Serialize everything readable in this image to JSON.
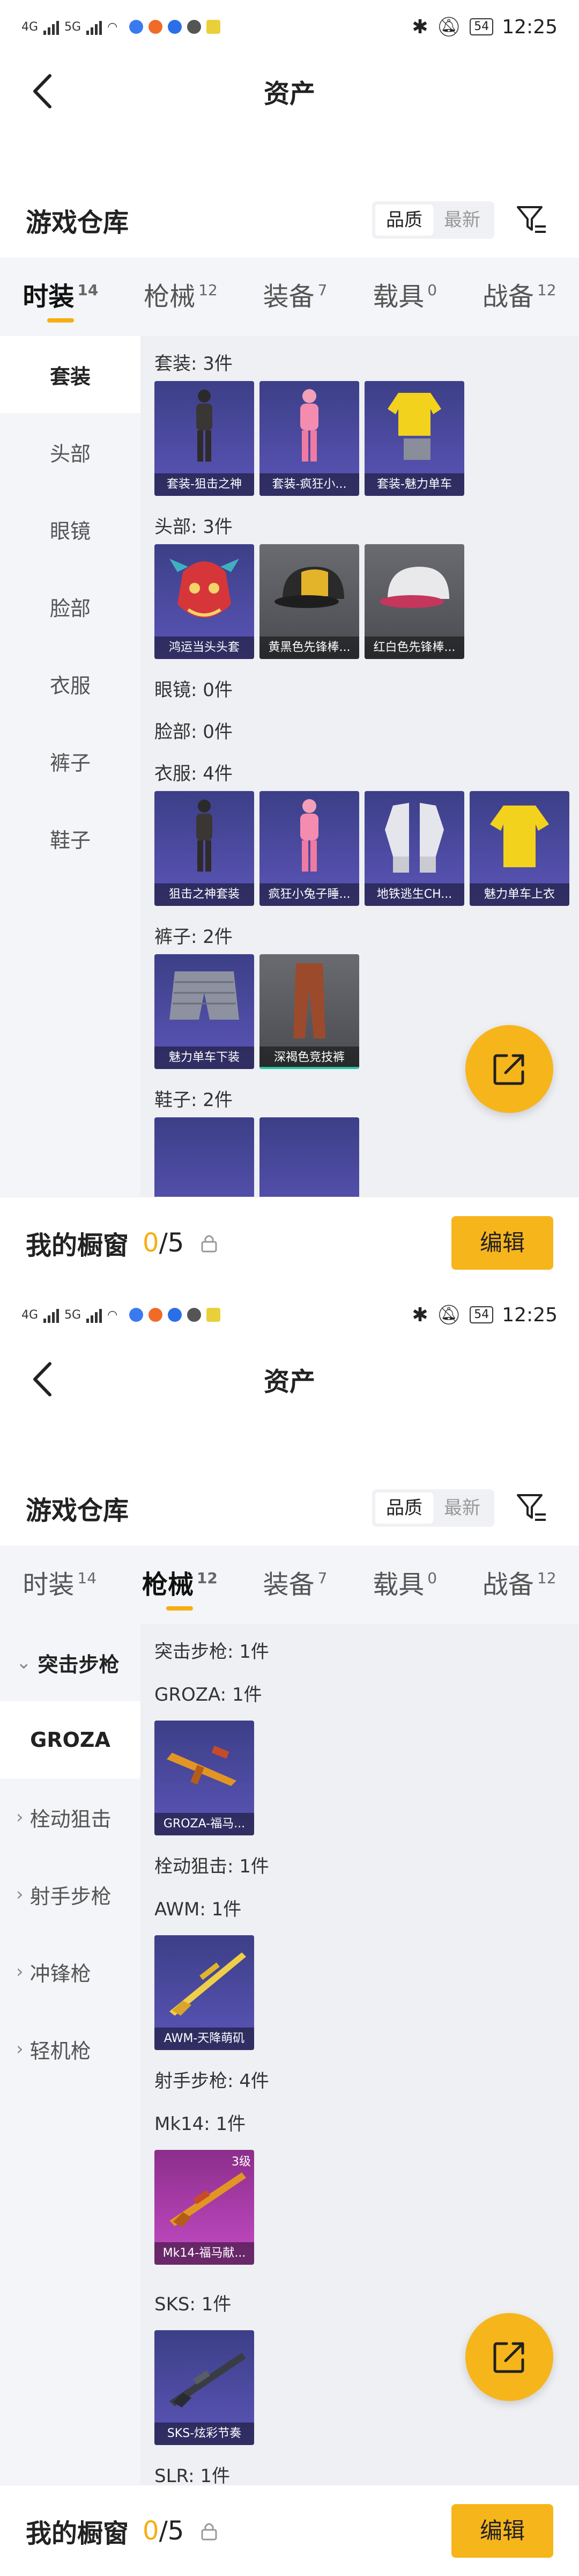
{
  "screens": [
    {
      "status": {
        "net": "4G",
        "net2": "5G",
        "time": "12:25",
        "battery": "54"
      },
      "nav": {
        "title": "资产"
      },
      "warehouse": {
        "title": "游戏仓库",
        "sort_quality": "品质",
        "sort_latest": "最新"
      },
      "tabs": [
        {
          "label": "时装",
          "count": "14"
        },
        {
          "label": "枪械",
          "count": "12"
        },
        {
          "label": "装备",
          "count": "7"
        },
        {
          "label": "载具",
          "count": "0"
        },
        {
          "label": "战备",
          "count": "12"
        }
      ],
      "sidebar": [
        "套装",
        "头部",
        "眼镜",
        "脸部",
        "衣服",
        "裤子",
        "鞋子"
      ],
      "sections": {
        "s1": "套装: 3件",
        "s1_items": [
          "套装-狙击之神",
          "套装-疯狂小...",
          "套装-魅力单车"
        ],
        "s2": "头部: 3件",
        "s2_items": [
          "鸿运当头头套",
          "黄黑色先锋棒...",
          "红白色先锋棒..."
        ],
        "s3": "眼镜: 0件",
        "s4": "脸部: 0件",
        "s5": "衣服: 4件",
        "s5_items": [
          "狙击之神套装",
          "疯狂小兔子睡...",
          "地铁逃生CH...",
          "魅力单车上衣"
        ],
        "s6": "裤子: 2件",
        "s6_items": [
          "魅力单车下装",
          "深褐色竞技裤"
        ],
        "s7": "鞋子: 2件"
      },
      "bottom": {
        "label": "我的橱窗",
        "count_current": "0",
        "count_total": "/5",
        "edit": "编辑"
      }
    },
    {
      "status": {
        "net": "4G",
        "net2": "5G",
        "time": "12:25",
        "battery": "54"
      },
      "nav": {
        "title": "资产"
      },
      "warehouse": {
        "title": "游戏仓库",
        "sort_quality": "品质",
        "sort_latest": "最新"
      },
      "tabs": [
        {
          "label": "时装",
          "count": "14"
        },
        {
          "label": "枪械",
          "count": "12"
        },
        {
          "label": "装备",
          "count": "7"
        },
        {
          "label": "载具",
          "count": "0"
        },
        {
          "label": "战备",
          "count": "12"
        }
      ],
      "sidebar": [
        "突击步枪",
        "GROZA",
        "栓动狙击",
        "射手步枪",
        "冲锋枪",
        "轻机枪"
      ],
      "sections": {
        "a1": "突击步枪: 1件",
        "a1_sub": "GROZA: 1件",
        "a1_item": "GROZA-福马...",
        "a2": "栓动狙击: 1件",
        "a2_sub": "AWM: 1件",
        "a2_item": "AWM-天降萌矶",
        "a3": "射手步枪: 4件",
        "a3_sub": "Mk14: 1件",
        "a3_item": "Mk14-福马献...",
        "a3_tier": "3级",
        "a3_sub2": "SKS: 1件",
        "a3_item2": "SKS-炫彩节奏",
        "a3_sub3": "SLR: 1件"
      },
      "bottom": {
        "label": "我的橱窗",
        "count_current": "0",
        "count_total": "/5",
        "edit": "编辑"
      }
    }
  ],
  "colors": {
    "accent": "#f7b51c",
    "tab_underline": "#f7ae12"
  }
}
